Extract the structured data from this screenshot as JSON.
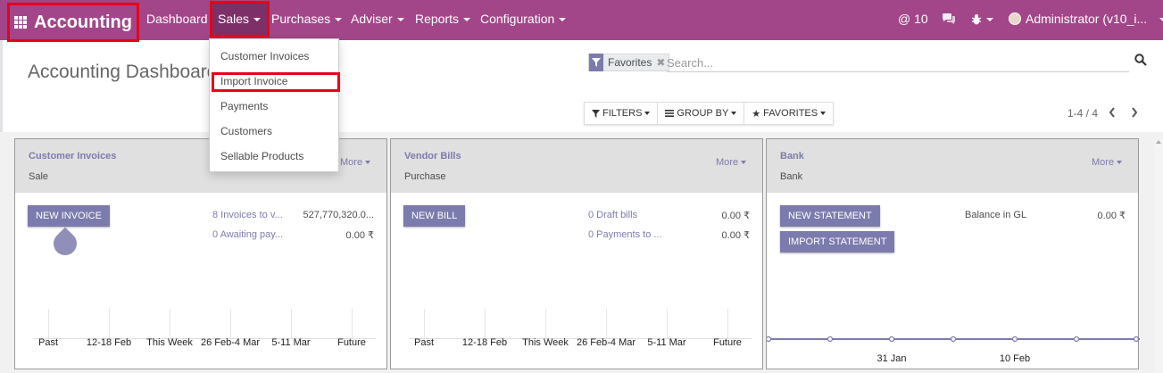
{
  "navbar": {
    "app_title": "Accounting",
    "menus": [
      {
        "label": "Dashboard"
      },
      {
        "label": "Sales"
      },
      {
        "label": "Purchases"
      },
      {
        "label": "Adviser"
      },
      {
        "label": "Reports"
      },
      {
        "label": "Configuration"
      }
    ],
    "messages_count": "@ 10",
    "user": "Administrator (v10_i..."
  },
  "sales_dropdown": {
    "items": [
      "Customer Invoices",
      "Import Invoice",
      "Payments",
      "Customers",
      "Sellable Products"
    ]
  },
  "control_panel": {
    "title": "Accounting Dashboard",
    "facet_label": "Favorites",
    "search_placeholder": "Search...",
    "filters_label": "FILTERS",
    "groupby_label": "GROUP BY",
    "favorites_label": "FAVORITES",
    "pager": "1-4 / 4"
  },
  "cards": [
    {
      "name": "Customer Invoices",
      "subtitle": "Sale",
      "more": "More",
      "buttons": [
        "NEW INVOICE"
      ],
      "rows": [
        {
          "label": "8 Invoices to v...",
          "value": "527,770,320.0..."
        },
        {
          "label": "0 Awaiting pay...",
          "value": "0.00 ₹"
        }
      ],
      "x_labels": [
        "Past",
        "12-18 Feb",
        "This Week",
        "26 Feb-4 Mar",
        "5-11 Mar",
        "Future"
      ]
    },
    {
      "name": "Vendor Bills",
      "subtitle": "Purchase",
      "more": "More",
      "buttons": [
        "NEW BILL"
      ],
      "rows": [
        {
          "label": "0 Draft bills",
          "value": "0.00 ₹"
        },
        {
          "label": "0 Payments to ...",
          "value": "0.00 ₹"
        }
      ],
      "x_labels": [
        "Past",
        "12-18 Feb",
        "This Week",
        "26 Feb-4 Mar",
        "5-11 Mar",
        "Future"
      ]
    },
    {
      "name": "Bank",
      "subtitle": "Bank",
      "more": "More",
      "buttons": [
        "NEW STATEMENT",
        "IMPORT STATEMENT"
      ],
      "rows": [
        {
          "label": "Balance in GL",
          "value": "0.00 ₹"
        }
      ],
      "x_labels": [
        "31 Jan",
        "10 Feb"
      ]
    }
  ],
  "colors": {
    "navbar": "#a24689",
    "accent": "#7c7bad",
    "highlight_border": "#e8001c"
  },
  "icons": [
    "apps-grid-icon",
    "caret-down-icon",
    "chat-icon",
    "bug-icon",
    "filter-icon",
    "close-icon",
    "search-icon",
    "star-icon",
    "list-icon",
    "chevron-left-icon",
    "chevron-right-icon"
  ]
}
